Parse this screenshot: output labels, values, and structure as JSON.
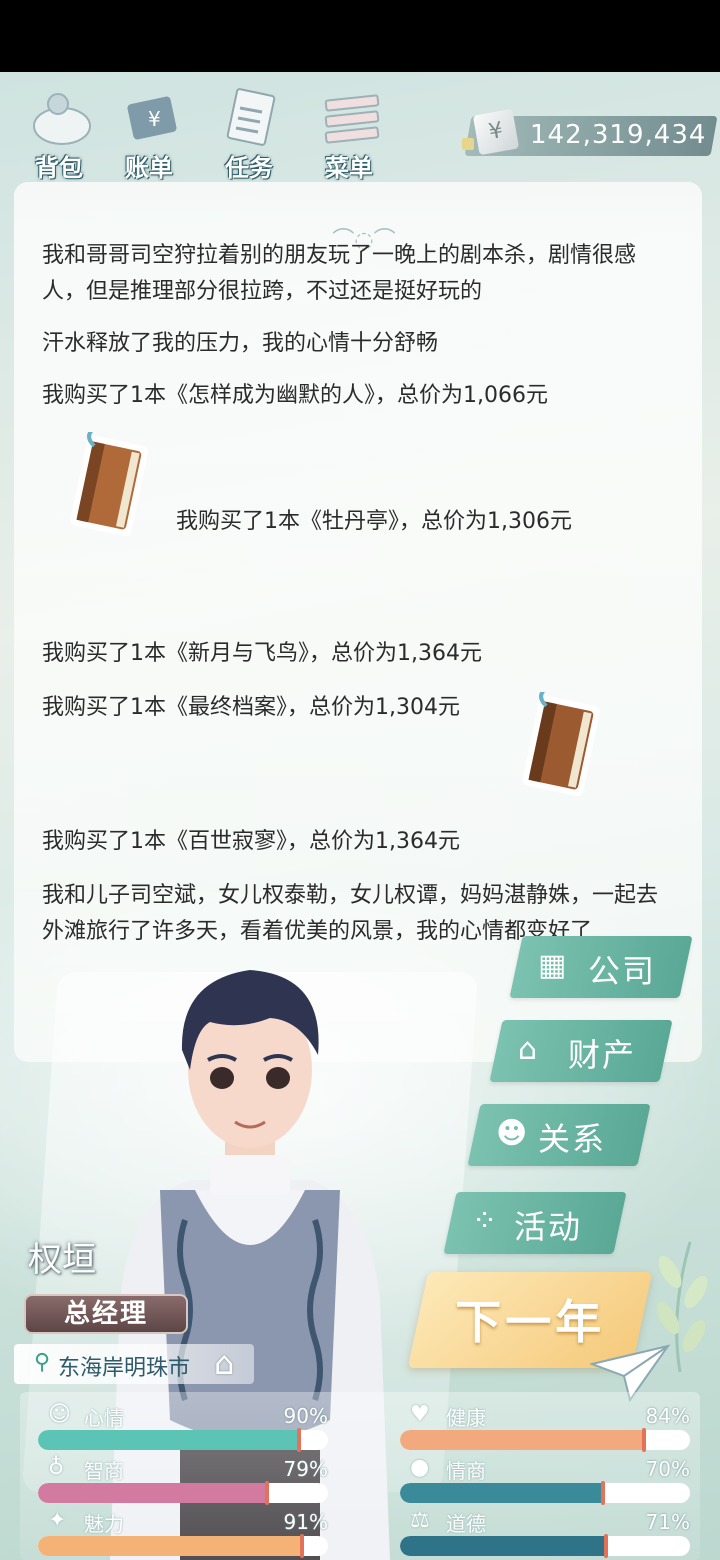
{
  "toolbar": {
    "bag_label": "背包",
    "ledger_label": "账单",
    "tasks_label": "任务",
    "menu_label": "菜单"
  },
  "money": {
    "symbol": "¥",
    "value": "142,319,434"
  },
  "log": {
    "entries": [
      "我和哥哥司空狩拉着别的朋友玩了一晚上的剧本杀，剧情很感人，但是推理部分很拉跨，不过还是挺好玩的",
      "汗水释放了我的压力，我的心情十分舒畅",
      "我购买了1本《怎样成为幽默的人》，总价为1,066元",
      "我购买了1本《牡丹亭》，总价为1,306元",
      "我购买了1本《新月与飞鸟》，总价为1,364元",
      "我购买了1本《最终档案》，总价为1,304元",
      "我购买了1本《百世寂寥》，总价为1,364元",
      "我和儿子司空斌，女儿权泰勒，女儿权谭，妈妈湛静姝，一起去外滩旅行了许多天，看着优美的风景，我的心情都变好了"
    ]
  },
  "actions": {
    "company": "公司",
    "assets": "财产",
    "relations": "关系",
    "activities": "活动",
    "next_year": "下一年"
  },
  "player": {
    "name": "权垣",
    "title": "总经理",
    "location": "东海岸明珠市"
  },
  "stats": {
    "mood": {
      "label": "心情",
      "pct": "90%",
      "value": 90,
      "color": "#5cc4b4"
    },
    "health": {
      "label": "健康",
      "pct": "84%",
      "value": 84,
      "color": "#f2a97e"
    },
    "iq": {
      "label": "智商",
      "pct": "79%",
      "value": 79,
      "color": "#d27aa0"
    },
    "eq": {
      "label": "情商",
      "pct": "70%",
      "value": 70,
      "color": "#3a8a99"
    },
    "charm": {
      "label": "魅力",
      "pct": "91%",
      "value": 91,
      "color": "#f4b277"
    },
    "morality": {
      "label": "道德",
      "pct": "71%",
      "value": 71,
      "color": "#2e7388"
    }
  }
}
